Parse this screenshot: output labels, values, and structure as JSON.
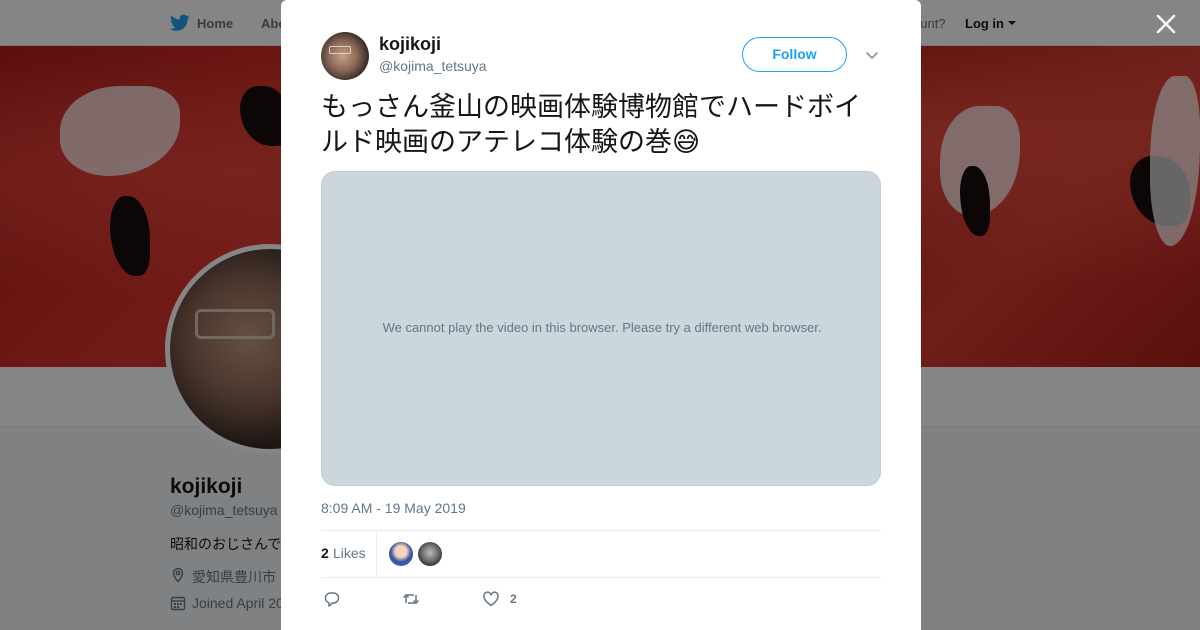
{
  "topbar": {
    "home_label": "Home",
    "about_label": "Abo",
    "account_question": "ccount?",
    "login_label": "Log in"
  },
  "profile": {
    "name": "kojikoji",
    "handle": "@kojima_tetsuya",
    "bio": "昭和のおじさんで",
    "location": "愛知県豊川市",
    "joined": "Joined April 20"
  },
  "tweet": {
    "author_name": "kojikoji",
    "author_handle": "@kojima_tetsuya",
    "follow_label": "Follow",
    "text": "もっさん釜山の映画体験博物館でハードボイルド映画のアテレコ体験の巻😅",
    "video_message": "We cannot play the video in this browser. Please try a different web browser.",
    "timestamp": "8:09 AM - 19 May 2019",
    "likes_count": "2",
    "likes_label": "Likes",
    "like_action_count": "2"
  },
  "icons": {
    "close": "close-icon",
    "caret": "chevron-down-icon",
    "reply": "reply-icon",
    "retweet": "retweet-icon",
    "like": "heart-icon",
    "brand": "twitter-bird-icon"
  },
  "colors": {
    "brand": "#1da1f2",
    "muted": "#657786",
    "video_bg": "#ccd6dd",
    "overlay": "rgba(0,0,0,0.48)"
  }
}
